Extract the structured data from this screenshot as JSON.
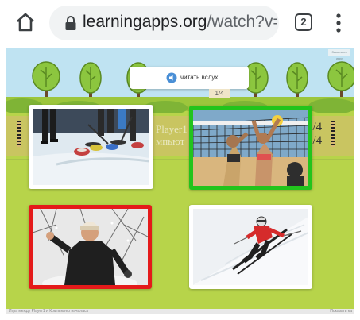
{
  "browser": {
    "url_domain": "learningapps.org",
    "url_path": "/watch?v=p",
    "tab_count": "2"
  },
  "game": {
    "read_aloud_label": "читать вслух",
    "round_counter": "1/4",
    "score_left": {
      "top": "",
      "bottom": ""
    },
    "score_right": {
      "top": "0/4",
      "bottom": "0/4"
    },
    "player_ghost_text": {
      "line1": "Player1",
      "line2": "мпьют"
    },
    "top_right_link": "Закончить игру",
    "status_text": "Игра между Player1 и Компьютер началась",
    "show_all_label": "Показать ка"
  },
  "cards": [
    {
      "id": "curling",
      "state": "neutral"
    },
    {
      "id": "volleyball",
      "state": "correct",
      "border_color": "#22c41c"
    },
    {
      "id": "snowball",
      "state": "wrong",
      "border_color": "#e41a1a"
    },
    {
      "id": "ski",
      "state": "neutral"
    }
  ],
  "icons": {
    "home": "home-icon",
    "lock": "lock-icon",
    "tabs": "tab-switcher-icon",
    "menu": "more-vert-icon",
    "speaker": "speaker-icon"
  }
}
